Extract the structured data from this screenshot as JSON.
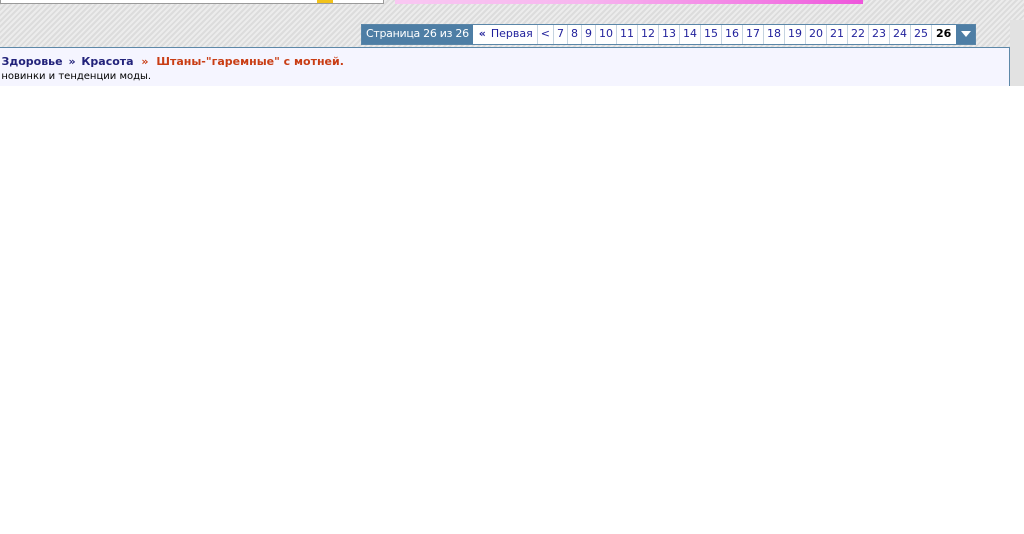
{
  "pagination": {
    "label": "Страница 26 из 26",
    "first": "Первая",
    "first_symbol": "«",
    "prev": "<",
    "pages": [
      "7",
      "8",
      "9",
      "10",
      "11",
      "12",
      "13",
      "14",
      "15",
      "16",
      "17",
      "18",
      "19",
      "20",
      "21",
      "22",
      "23",
      "24",
      "25"
    ],
    "current": "26",
    "dropdown_icon": "chevron-down-icon"
  },
  "breadcrumb": {
    "items": [
      "и Здоровье",
      "Красота"
    ],
    "separator": "»",
    "current": "Штаны-\"гаремные\" с мотней."
  },
  "forum_description": ", новинки и тенденции моды.",
  "colors": {
    "pager_accent": "#4e7ea5",
    "link": "#22229c",
    "current_title": "#c93d14",
    "panel_bg": "#f5f5ff"
  }
}
